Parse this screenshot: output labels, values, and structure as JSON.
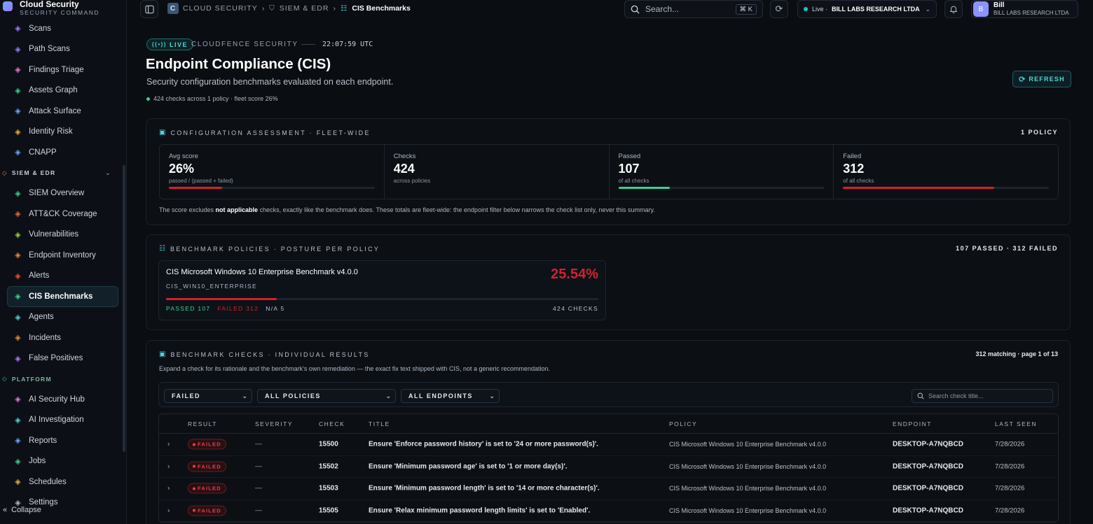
{
  "brand": {
    "title": "Cloud Security",
    "subtitle": "SECURITY COMMAND"
  },
  "sidebar": {
    "items_top": [
      {
        "label": "Scans",
        "icon": "scan-icon",
        "color": "#9f7bff"
      },
      {
        "label": "Path Scans",
        "icon": "path-scan-icon",
        "color": "#9f7bff"
      },
      {
        "label": "Findings Triage",
        "icon": "triage-icon",
        "color": "#e57bd4"
      },
      {
        "label": "Assets Graph",
        "icon": "graph-icon",
        "color": "#3fcf8e"
      },
      {
        "label": "Attack Surface",
        "icon": "globe-icon",
        "color": "#6aa8ff"
      },
      {
        "label": "Identity Risk",
        "icon": "key-icon",
        "color": "#e8b03c"
      },
      {
        "label": "CNAPP",
        "icon": "cube-icon",
        "color": "#6aa8ff"
      }
    ],
    "section_siem": "SIEM & EDR",
    "items_siem": [
      {
        "label": "SIEM Overview",
        "icon": "shield-icon",
        "color": "#3fcf8e"
      },
      {
        "label": "ATT&CK Coverage",
        "icon": "target-icon",
        "color": "#f06a3c"
      },
      {
        "label": "Vulnerabilities",
        "icon": "bug-icon",
        "color": "#9fd13c"
      },
      {
        "label": "Endpoint Inventory",
        "icon": "box-icon",
        "color": "#f08a3c"
      },
      {
        "label": "Alerts",
        "icon": "siren-icon",
        "color": "#f0503c"
      },
      {
        "label": "CIS Benchmarks",
        "icon": "checklist-icon",
        "color": "#3fcf8e",
        "active": true
      },
      {
        "label": "Agents",
        "icon": "monitor-icon",
        "color": "#4fd6d6"
      },
      {
        "label": "Incidents",
        "icon": "flame-icon",
        "color": "#f08a3c"
      },
      {
        "label": "False Positives",
        "icon": "x-icon",
        "color": "#b07bff"
      }
    ],
    "section_platform": "PLATFORM",
    "items_platform": [
      {
        "label": "AI Security Hub",
        "icon": "sparkle-icon",
        "color": "#e57bd4"
      },
      {
        "label": "AI Investigation",
        "icon": "ai-icon",
        "color": "#4fd6d6"
      },
      {
        "label": "Reports",
        "icon": "document-icon",
        "color": "#6aa8ff"
      },
      {
        "label": "Jobs",
        "icon": "list-icon",
        "color": "#3fcf8e"
      },
      {
        "label": "Schedules",
        "icon": "calendar-icon",
        "color": "#e8b03c"
      },
      {
        "label": "Settings",
        "icon": "gear-icon",
        "color": "#aeb6c0"
      }
    ],
    "collapse_label": "Collapse"
  },
  "topbar": {
    "breadcrumb_logo": "C",
    "crumb1": "CLOUD SECURITY",
    "crumb2": "SIEM & EDR",
    "crumb3": "CIS Benchmarks",
    "search_placeholder": "Search...",
    "search_shortcut": "⌘ K",
    "tenant_status": "Live ·",
    "tenant_name": "BILL LABS RESEARCH LTDA",
    "user_initial": "B",
    "user_name": "Bill",
    "user_org": "BILL LABS RESEARCH LTDA"
  },
  "header": {
    "live_label": "LIVE",
    "org": "CLOUDFENCE SECURITY",
    "time": "22:07:59 UTC",
    "title": "Endpoint Compliance (CIS)",
    "subtitle": "Security configuration benchmarks evaluated on each endpoint.",
    "summary": "424 checks across 1 policy · fleet score 26%",
    "refresh_label": "REFRESH"
  },
  "assessment": {
    "title": "CONFIGURATION ASSESSMENT · FLEET-WIDE",
    "right": "1 POLICY",
    "stats": [
      {
        "label": "Avg score",
        "value": "26%",
        "sub": "passed / (passed + failed)",
        "fill": 0.26,
        "color": "#d3212c"
      },
      {
        "label": "Checks",
        "value": "424",
        "sub": "across policies"
      },
      {
        "label": "Passed",
        "value": "107",
        "sub": "of all checks",
        "fill": 0.25,
        "color": "#3fcf8e"
      },
      {
        "label": "Failed",
        "value": "312",
        "sub": "of all checks",
        "fill": 0.736,
        "color": "#d3212c"
      }
    ],
    "note_pre": "The score excludes ",
    "note_bold": "not applicable",
    "note_post": " checks, exactly like the benchmark does. These totals are fleet-wide: the endpoint filter below narrows the check list only, never this summary."
  },
  "policies": {
    "title": "BENCHMARK POLICIES · POSTURE PER POLICY",
    "right": "107 PASSED · 312 FAILED",
    "card": {
      "name": "CIS Microsoft Windows 10 Enterprise Benchmark v4.0.0",
      "id": "CIS_WIN10_ENTERPRISE",
      "score": "25.54%",
      "fill": 0.2554,
      "passed": "PASSED 107",
      "failed": "FAILED 312",
      "na": "N/A 5",
      "checks": "424 CHECKS"
    }
  },
  "checks": {
    "title": "BENCHMARK CHECKS · INDIVIDUAL RESULTS",
    "right": "312 matching · page 1 of 13",
    "explanation": "Expand a check for its rationale and the benchmark's own remediation — the exact fix text shipped with CIS, not a generic recommendation.",
    "filters": {
      "result": "FAILED",
      "policy": "ALL POLICIES",
      "endpoint": "ALL ENDPOINTS",
      "search_placeholder": "Search check title..."
    },
    "columns": [
      "RESULT",
      "SEVERITY",
      "CHECK",
      "TITLE",
      "POLICY",
      "ENDPOINT",
      "LAST SEEN"
    ],
    "rows": [
      {
        "result": "FAILED",
        "severity": "—",
        "check": "15500",
        "title": "Ensure 'Enforce password history' is set to '24 or more password(s)'.",
        "policy": "CIS Microsoft Windows 10 Enterprise Benchmark v4.0.0",
        "endpoint": "DESKTOP-A7NQBCD",
        "last_seen": "7/28/2026"
      },
      {
        "result": "FAILED",
        "severity": "—",
        "check": "15502",
        "title": "Ensure 'Minimum password age' is set to '1 or more day(s)'.",
        "policy": "CIS Microsoft Windows 10 Enterprise Benchmark v4.0.0",
        "endpoint": "DESKTOP-A7NQBCD",
        "last_seen": "7/28/2026"
      },
      {
        "result": "FAILED",
        "severity": "—",
        "check": "15503",
        "title": "Ensure 'Minimum password length' is set to '14 or more character(s)'.",
        "policy": "CIS Microsoft Windows 10 Enterprise Benchmark v4.0.0",
        "endpoint": "DESKTOP-A7NQBCD",
        "last_seen": "7/28/2026"
      },
      {
        "result": "FAILED",
        "severity": "—",
        "check": "15505",
        "title": "Ensure 'Relax minimum password length limits' is set to 'Enabled'.",
        "policy": "CIS Microsoft Windows 10 Enterprise Benchmark v4.0.0",
        "endpoint": "DESKTOP-A7NQBCD",
        "last_seen": "7/28/2026"
      }
    ]
  }
}
